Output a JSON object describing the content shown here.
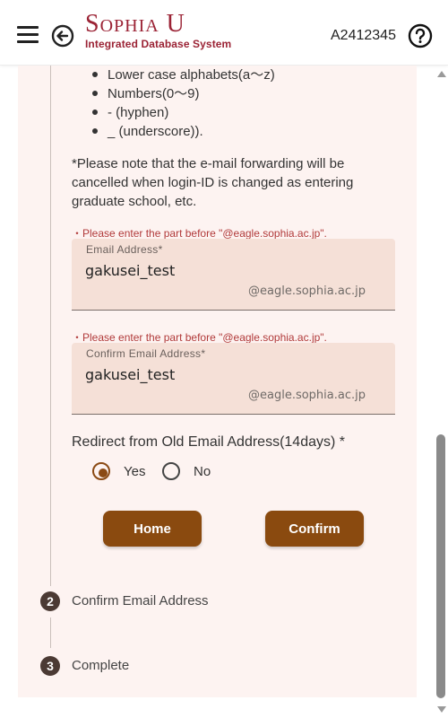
{
  "header": {
    "logo_title": "Sophia U",
    "logo_subtitle": "Integrated Database System",
    "user_id": "A2412345"
  },
  "requirements": {
    "items": [
      "Lower case alphabets(a～z)",
      "Numbers(0～9)",
      "- (hyphen)",
      "_ (underscore))."
    ]
  },
  "note": "*Please note that the e-mail forwarding will be cancelled when login-ID is changed as entering graduate school, etc.",
  "email": {
    "hint": "・Please enter the part before \"@eagle.sophia.ac.jp\".",
    "label": "Email Address*",
    "value": "gakusei_test",
    "suffix": "@eagle.sophia.ac.jp"
  },
  "confirm_email": {
    "hint": "・Please enter the part before \"@eagle.sophia.ac.jp\".",
    "label": "Confirm Email Address*",
    "value": "gakusei_test",
    "suffix": "@eagle.sophia.ac.jp"
  },
  "redirect": {
    "label": "Redirect from Old Email Address(14days) *",
    "options": [
      {
        "label": "Yes",
        "selected": true
      },
      {
        "label": "No",
        "selected": false
      }
    ]
  },
  "buttons": {
    "home": "Home",
    "confirm": "Confirm"
  },
  "steps": [
    {
      "number": "2",
      "label": "Confirm Email Address"
    },
    {
      "number": "3",
      "label": "Complete"
    }
  ],
  "colors": {
    "brand": "#9b2335",
    "button": "#8a4a0f",
    "card_bg": "#fdf3f1",
    "field_bg": "#f5e0d7",
    "hint": "#b13a3a"
  },
  "icons": {
    "menu": "hamburger-menu-icon",
    "back": "back-arrow-circle-icon",
    "help": "help-circle-icon"
  }
}
